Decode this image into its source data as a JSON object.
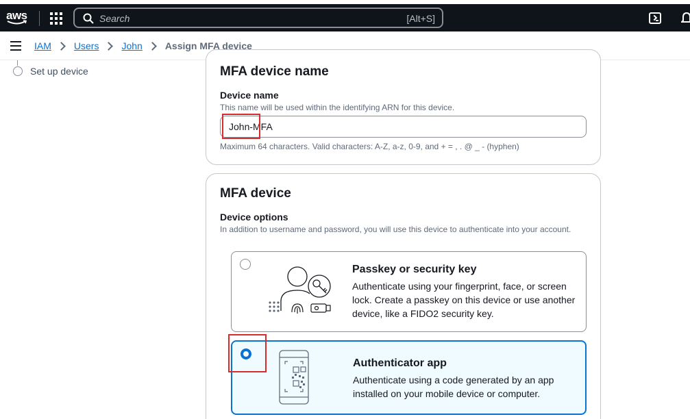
{
  "topbar": {
    "logo_text": "aws",
    "search": {
      "placeholder": "Search",
      "shortcut": "[Alt+S]"
    },
    "icons": [
      "apps-grid-icon",
      "search-icon",
      "cloudshell-icon",
      "notifications-bell-icon"
    ]
  },
  "breadcrumb": {
    "items": [
      {
        "label": "IAM"
      },
      {
        "label": "Users"
      },
      {
        "label": "John"
      }
    ],
    "current": "Assign MFA device"
  },
  "steps": {
    "current_step": "Set up device"
  },
  "device_name_section": {
    "title": "MFA device name",
    "field_label": "Device name",
    "description": "This name will be used within the identifying ARN for this device.",
    "value": "John-MFA",
    "constraint": "Maximum 64 characters. Valid characters: A-Z, a-z, 0-9, and + = , . @ _ - (hyphen)"
  },
  "mfa_device_section": {
    "title": "MFA device",
    "field_label": "Device options",
    "description": "In addition to username and password, you will use this device to authenticate into your account.",
    "options": [
      {
        "title": "Passkey or security key",
        "description": "Authenticate using your fingerprint, face, or screen lock. Create a passkey on this device or use another device, like a FIDO2 security key.",
        "selected": false,
        "icon": "passkey-illustration-icon"
      },
      {
        "title": "Authenticator app",
        "description": "Authenticate using a code generated by an app installed on your mobile device or computer.",
        "selected": true,
        "icon": "authenticator-app-illustration-icon"
      }
    ]
  },
  "colors": {
    "nav_background": "#0f141a",
    "link": "#0972d3",
    "selected_border": "#0972d3",
    "selected_background": "#f0fbff",
    "annotation": "#d82c2c"
  }
}
